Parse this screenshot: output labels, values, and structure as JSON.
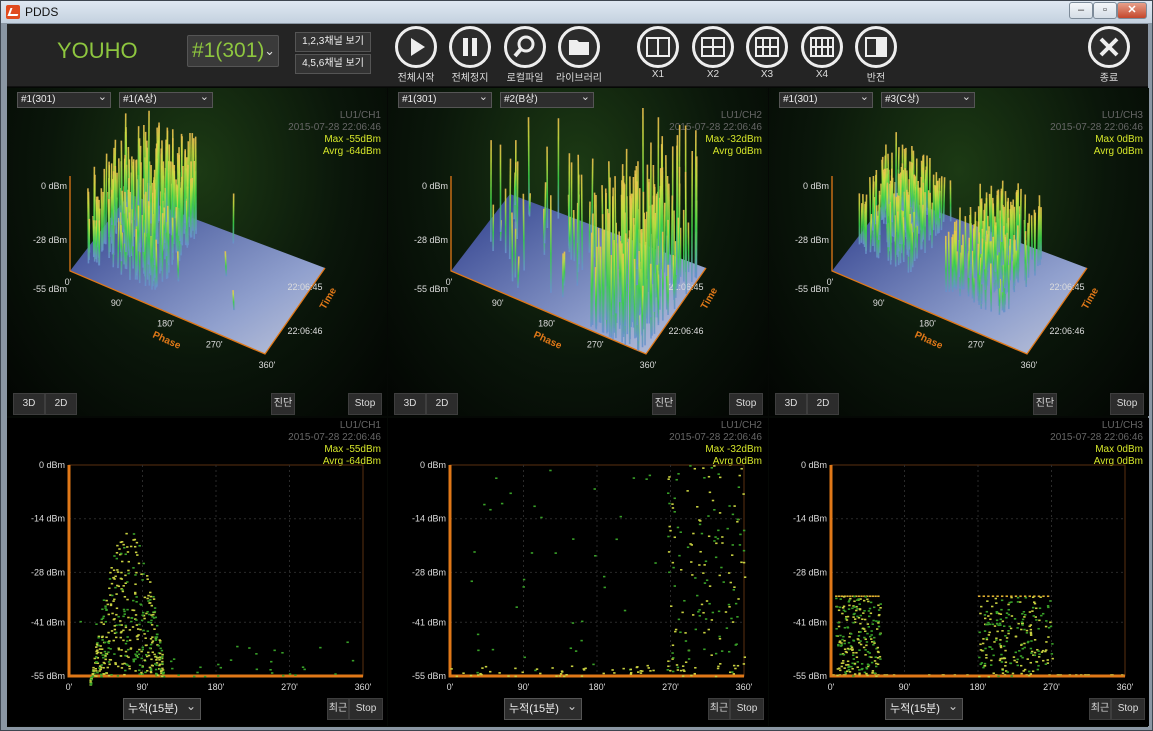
{
  "window": {
    "title": "PDDS"
  },
  "toolbar": {
    "brand": "YOUHO",
    "unit_selected": "#1(301)",
    "view_123": "1,2,3채널 보기",
    "view_456": "4,5,6채널 보기",
    "buttons": {
      "start_all": "전체시작",
      "stop_all": "전체정지",
      "log_file": "로컬파일",
      "library": "라이브러리",
      "x1": "X1",
      "x2": "X2",
      "x3": "X3",
      "x4": "X4",
      "invert": "반전",
      "exit": "종료"
    }
  },
  "panel_controls": {
    "btn_3d": "3D",
    "btn_2d": "2D",
    "btn_diagnose": "진단",
    "btn_stop": "Stop",
    "btn_recent": "최근",
    "mode": "누적(15분)"
  },
  "labels": {
    "phase": "Phase",
    "time": "Time"
  },
  "channels": [
    {
      "unit": "#1(301)",
      "sensor": "#1(A상)",
      "name": "LU1/CH1",
      "timestamp": "2015-07-28 22:06:46",
      "max": "Max -55dBm",
      "avg": "Avrg -64dBm"
    },
    {
      "unit": "#1(301)",
      "sensor": "#2(B상)",
      "name": "LU1/CH2",
      "timestamp": "2015-07-28 22:06:46",
      "max": "Max -32dBm",
      "avg": "Avrg 0dBm"
    },
    {
      "unit": "#1(301)",
      "sensor": "#3(C상)",
      "name": "LU1/CH3",
      "timestamp": "2015-07-28 22:06:46",
      "max": "Max 0dBm",
      "avg": "Avrg 0dBm"
    }
  ],
  "chart_data": {
    "prpd_2d": {
      "type": "scatter",
      "xlabel": "",
      "ylabel": "",
      "xlim": [
        0,
        360
      ],
      "ylim": [
        -55,
        0
      ],
      "x_ticks": [
        "0'",
        "90'",
        "180'",
        "270'",
        "360'"
      ],
      "y_ticks": [
        "0 dBm",
        "-14 dBm",
        "-28 dBm",
        "-41 dBm",
        "-55 dBm"
      ],
      "grid": true,
      "series": [
        {
          "channel": "LU1/CH1",
          "clusters": [
            {
              "x0": 25,
              "x1": 110,
              "y_top": -17,
              "note": "dome"
            }
          ]
        },
        {
          "channel": "LU1/CH2",
          "clusters": [
            {
              "x0": 270,
              "x1": 360,
              "y_top": 0,
              "note": "sparse"
            }
          ]
        },
        {
          "channel": "LU1/CH3",
          "clusters": [
            {
              "x0": 5,
              "x1": 60,
              "y_top": -34
            },
            {
              "x0": 180,
              "x1": 270,
              "y_top": -34
            }
          ]
        }
      ]
    },
    "prpd_3d": {
      "type": "area",
      "z_ticks": [
        "0 dBm",
        "-28 dBm",
        "-55 dBm"
      ],
      "x_ticks": [
        "0'",
        "90'",
        "180'",
        "270'",
        "360'"
      ],
      "t_ticks": [
        "22:06:45",
        "22:06:46"
      ]
    }
  },
  "colors": {
    "accent": "#8ec63f",
    "axis": "#e07818",
    "info": "#d6e72a"
  }
}
